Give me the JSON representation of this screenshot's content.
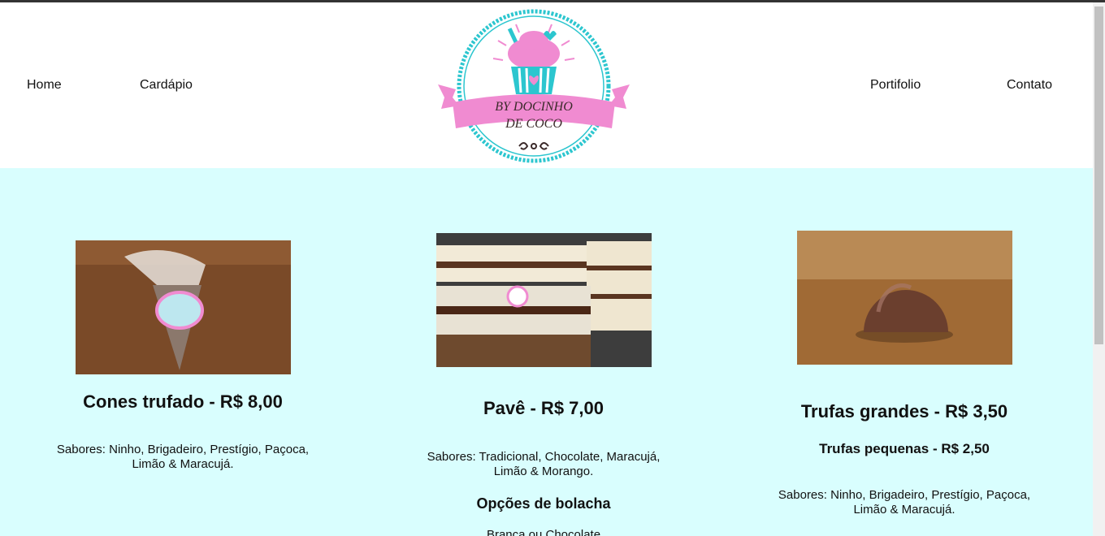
{
  "nav": {
    "left": [
      "Home",
      "Cardápio"
    ],
    "right": [
      "Portifolio",
      "Contato"
    ]
  },
  "logo": {
    "line1": "BY DOCINHO",
    "line2": "DE COCO"
  },
  "colors": {
    "band": "#d9fefe",
    "teal": "#2cc6cf",
    "pink": "#f08bd1"
  },
  "products": [
    {
      "title": "Cones trufado - R$ 8,00",
      "flavors_line1": "Sabores: Ninho, Brigadeiro, Prestígio, Paçoca,",
      "flavors_line2": "Limão & Maracujá."
    },
    {
      "title": "Pavê - R$ 7,00",
      "flavors_line1": "Sabores: Tradicional, Chocolate, Maracujá,",
      "flavors_line2": "Limão & Morango.",
      "options_title": "Opções de bolacha",
      "options_text": "Branca ou Chocolate"
    },
    {
      "title": "Trufas grandes - R$ 3,50",
      "subtitle": "Trufas pequenas - R$ 2,50",
      "flavors_line1": "Sabores: Ninho, Brigadeiro, Prestígio, Paçoca,",
      "flavors_line2": "Limão & Maracujá."
    }
  ]
}
